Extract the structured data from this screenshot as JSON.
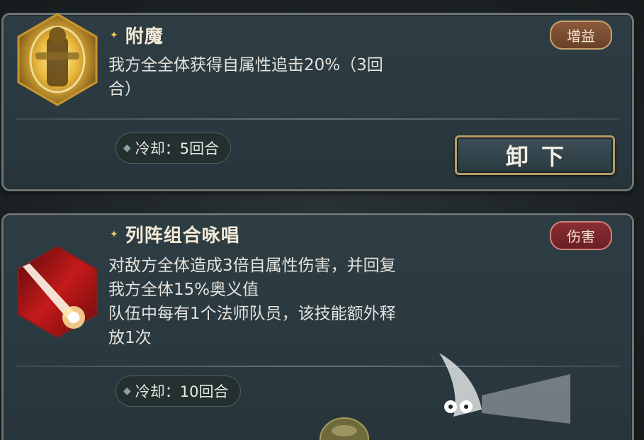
{
  "skills": [
    {
      "name": "附魔",
      "tag": "增益",
      "desc": [
        "我方全全体获得自属性追击20%（3回",
        "合）"
      ],
      "cooldown": "冷却：5回合",
      "action_label": "卸下",
      "icon": "golden-knight-icon"
    },
    {
      "name": "列阵组合咏唱",
      "tag": "伤害",
      "desc": [
        "对敌方全体造成3倍自属性伤害，并回复",
        "我方全体15%奥义值",
        "队伍中每有1个法师队员，该技能额外释",
        "放1次"
      ],
      "cooldown": "冷却：10回合",
      "icon": "red-slash-icon"
    }
  ],
  "colors": {
    "buff_tag": "#8a5a3a",
    "damage_tag": "#8a2e34",
    "title": "#f3ead6",
    "accent": "#f2c75a"
  }
}
